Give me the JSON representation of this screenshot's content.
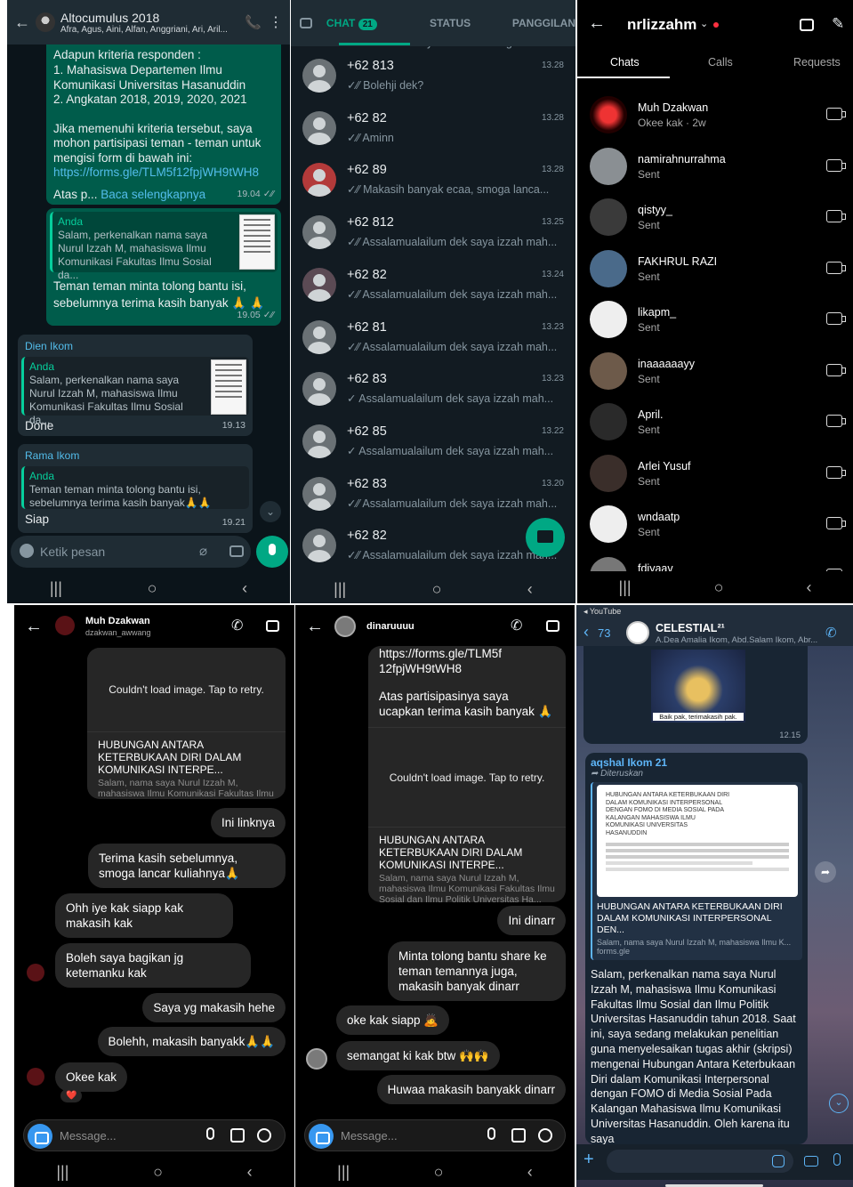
{
  "wa_group": {
    "title": "Altocumulus 2018",
    "members": "Afra, Agus, Aini, Alfan, Anggriani, Ari, Aril...",
    "m1": {
      "lines": [
        "Adapun kriteria responden :",
        "1. Mahasiswa Departemen Ilmu",
        "Komunikasi Universitas Hasanuddin",
        "2. Angkatan 2018, 2019, 2020, 2021",
        "",
        "Jika memenuhi kriteria tersebut, saya",
        "mohon partisipasi teman - teman untuk",
        "mengisi form di bawah ini:"
      ],
      "link": "https://forms.gle/TLM5f12fpjWH9tWH8",
      "more_prefix": "Atas p...",
      "more": "Baca selengkapnya",
      "time": "19.04 ✓⁄⁄"
    },
    "m2": {
      "qname": "Anda",
      "qtext": "Salam, perkenalkan nama saya Nurul Izzah M, mahasiswa Ilmu Komunikasi Fakultas Ilmu Sosial da...",
      "text": "Teman teman minta tolong bantu isi, sebelumnya terima kasih banyak 🙏 🙏",
      "time": "19.05 ✓⁄⁄"
    },
    "m3": {
      "sender": "Dien Ikom",
      "qname": "Anda",
      "qtext": "Salam, perkenalkan nama saya Nurul Izzah M, mahasiswa Ilmu Komunikasi Fakultas Ilmu Sosial da...",
      "text": "Done",
      "time": "19.13"
    },
    "m4": {
      "sender": "Rama Ikom",
      "qname": "Anda",
      "qtext": "Teman teman minta tolong bantu isi, sebelumnya terima kasih banyak🙏🙏",
      "text": "Siap",
      "time": "19.21"
    },
    "input_placeholder": "Ketik pesan"
  },
  "wa_chats": {
    "tabs": [
      "CHAT",
      "STATUS",
      "PANGGILAN"
    ],
    "badge": "21",
    "top_preview": "✓⁄⁄ Makasih banyak auraa semoga lanca...",
    "rows": [
      {
        "name": "+62 813",
        "time": "13.28",
        "msg": "✓⁄⁄ Bolehji dek?"
      },
      {
        "name": "+62 82",
        "time": "13.28",
        "msg": "✓⁄⁄ Aminn"
      },
      {
        "name": "+62 89",
        "time": "13.28",
        "msg": "✓⁄⁄ Makasih banyak ecaa, smoga lanca..."
      },
      {
        "name": "+62 812",
        "time": "13.25",
        "msg": "✓⁄⁄ Assalamualailum dek saya izzah mah..."
      },
      {
        "name": "+62 82",
        "time": "13.24",
        "msg": "✓⁄⁄ Assalamualailum dek saya izzah mah..."
      },
      {
        "name": "+62 81",
        "time": "13.23",
        "msg": "✓⁄⁄ Assalamualailum dek saya izzah mah..."
      },
      {
        "name": "+62 83",
        "time": "13.23",
        "msg": "✓ Assalamualailum dek saya izzah mah..."
      },
      {
        "name": "+62 85",
        "time": "13.22",
        "msg": "✓ Assalamualailum dek saya izzah mah..."
      },
      {
        "name": "+62 83",
        "time": "13.20",
        "msg": "✓⁄⁄ Assalamualailum dek saya izzah mah..."
      },
      {
        "name": "+62 82",
        "time": "",
        "msg": "✓⁄⁄ Assalamualailum dek saya izzah mah..."
      }
    ]
  },
  "ig_list": {
    "username": "nrlizzahm",
    "tabs": [
      "Chats",
      "Calls",
      "Requests"
    ],
    "rows": [
      {
        "name": "Muh Dzakwan",
        "sub": "Okee kak · 2w"
      },
      {
        "name": "namirahnurrahma",
        "sub": "Sent"
      },
      {
        "name": "qistyy_",
        "sub": "Sent"
      },
      {
        "name": "FAKHRUL RAZI",
        "sub": "Sent"
      },
      {
        "name": "likapm_",
        "sub": "Sent"
      },
      {
        "name": "inaaaaaayy",
        "sub": "Sent"
      },
      {
        "name": "April.",
        "sub": "Sent"
      },
      {
        "name": "Arlei Yusuf",
        "sub": "Sent"
      },
      {
        "name": "wndaatp",
        "sub": "Sent"
      },
      {
        "name": "fdiyaav",
        "sub": ""
      }
    ]
  },
  "ig_chat1": {
    "name": "Muh Dzakwan",
    "handle": "dzakwan_awwang",
    "card": {
      "img": "Couldn't load image. Tap to retry.",
      "title": "HUBUNGAN ANTARA KETERBUKAAN DIRI DALAM KOMUNIKASI INTERPE...",
      "desc": "Salam, nama saya Nurul Izzah M, mahasiswa Ilmu Komunikasi Fakultas Ilmu Sosial dan Ilmu Politik Universitas Ha..."
    },
    "msgs": [
      "Ini linknya",
      "Terima kasih sebelumnya, smoga lancar kuliahnya🙏",
      "Ohh iye kak siapp kak makasih kak",
      "Boleh saya bagikan jg ketemanku kak",
      "Saya yg makasih hehe",
      "Bolehh, makasih banyakk🙏🙏",
      "Okee kak"
    ],
    "reaction": "❤️",
    "placeholder": "Message..."
  },
  "ig_chat2": {
    "name": "dinaruuuu",
    "link_text": "https://forms.gle/TLM5f12fpjWH9tWH8",
    "thanks": "Atas partisipasinya saya ucapkan terima kasih banyak 🙏",
    "card": {
      "img": "Couldn't load image. Tap to retry.",
      "title": "HUBUNGAN ANTARA KETERBUKAAN DIRI DALAM KOMUNIKASI INTERPE...",
      "desc": "Salam, nama saya Nurul Izzah M, mahasiswa Ilmu Komunikasi Fakultas Ilmu Sosial dan Ilmu Politik Universitas Ha..."
    },
    "msgs": [
      "Ini dinarr",
      "Minta tolong bantu share ke teman temannya juga, makasih banyak dinarr",
      "oke kak siapp 🙇",
      "semangat ki kak btw 🙌🙌",
      "Huwaa makasih banyakk dinarr"
    ],
    "placeholder": "Message..."
  },
  "telegram": {
    "status": "◂ YouTube",
    "back": "73",
    "title": "CELESTIAL²¹",
    "members": "A.Dea Amalia Ikom, Abd.Salam Ikom, Abr...",
    "img_caption": "Baik pak, terimakasih pak.",
    "img_time": "12.15",
    "sender": "aqshal Ikom 21",
    "forwarded": "Diteruskan",
    "preview_title": "HUBUNGAN ANTARA KETERBUKAAN DIRI DALAM KOMUNIKASI INTERPERSONAL DEN...",
    "preview_desc": "Salam, nama saya Nurul Izzah M, mahasiswa Ilmu K...",
    "preview_site": "forms.gle",
    "doc_title": "HUBUNGAN ANTARA KETERBUKAAN DIRI DALAM KOMUNIKASI INTERPERSONAL DENGAN FOMO DI MEDIA SOSIAL PADA KALANGAN MAHASISWA ILMU KOMUNIKASI UNIVERSITAS HASANUDDIN",
    "body": "Salam, perkenalkan nama saya Nurul Izzah M, mahasiswa Ilmu Komunikasi Fakultas Ilmu Sosial dan Ilmu Politik Universitas Hasanuddin tahun 2018. Saat ini, saya sedang melakukan penelitian guna menyelesaikan tugas akhir (skripsi) mengenai Hubungan Antara Keterbukaan Diri dalam Komunikasi Interpersonal dengan FOMO di Media Sosial Pada Kalangan Mahasiswa Ilmu Komunikasi Universitas Hasanuddin. Oleh karena itu saya"
  },
  "nav": {
    "recent": "|||",
    "home": "○",
    "back": "‹"
  }
}
